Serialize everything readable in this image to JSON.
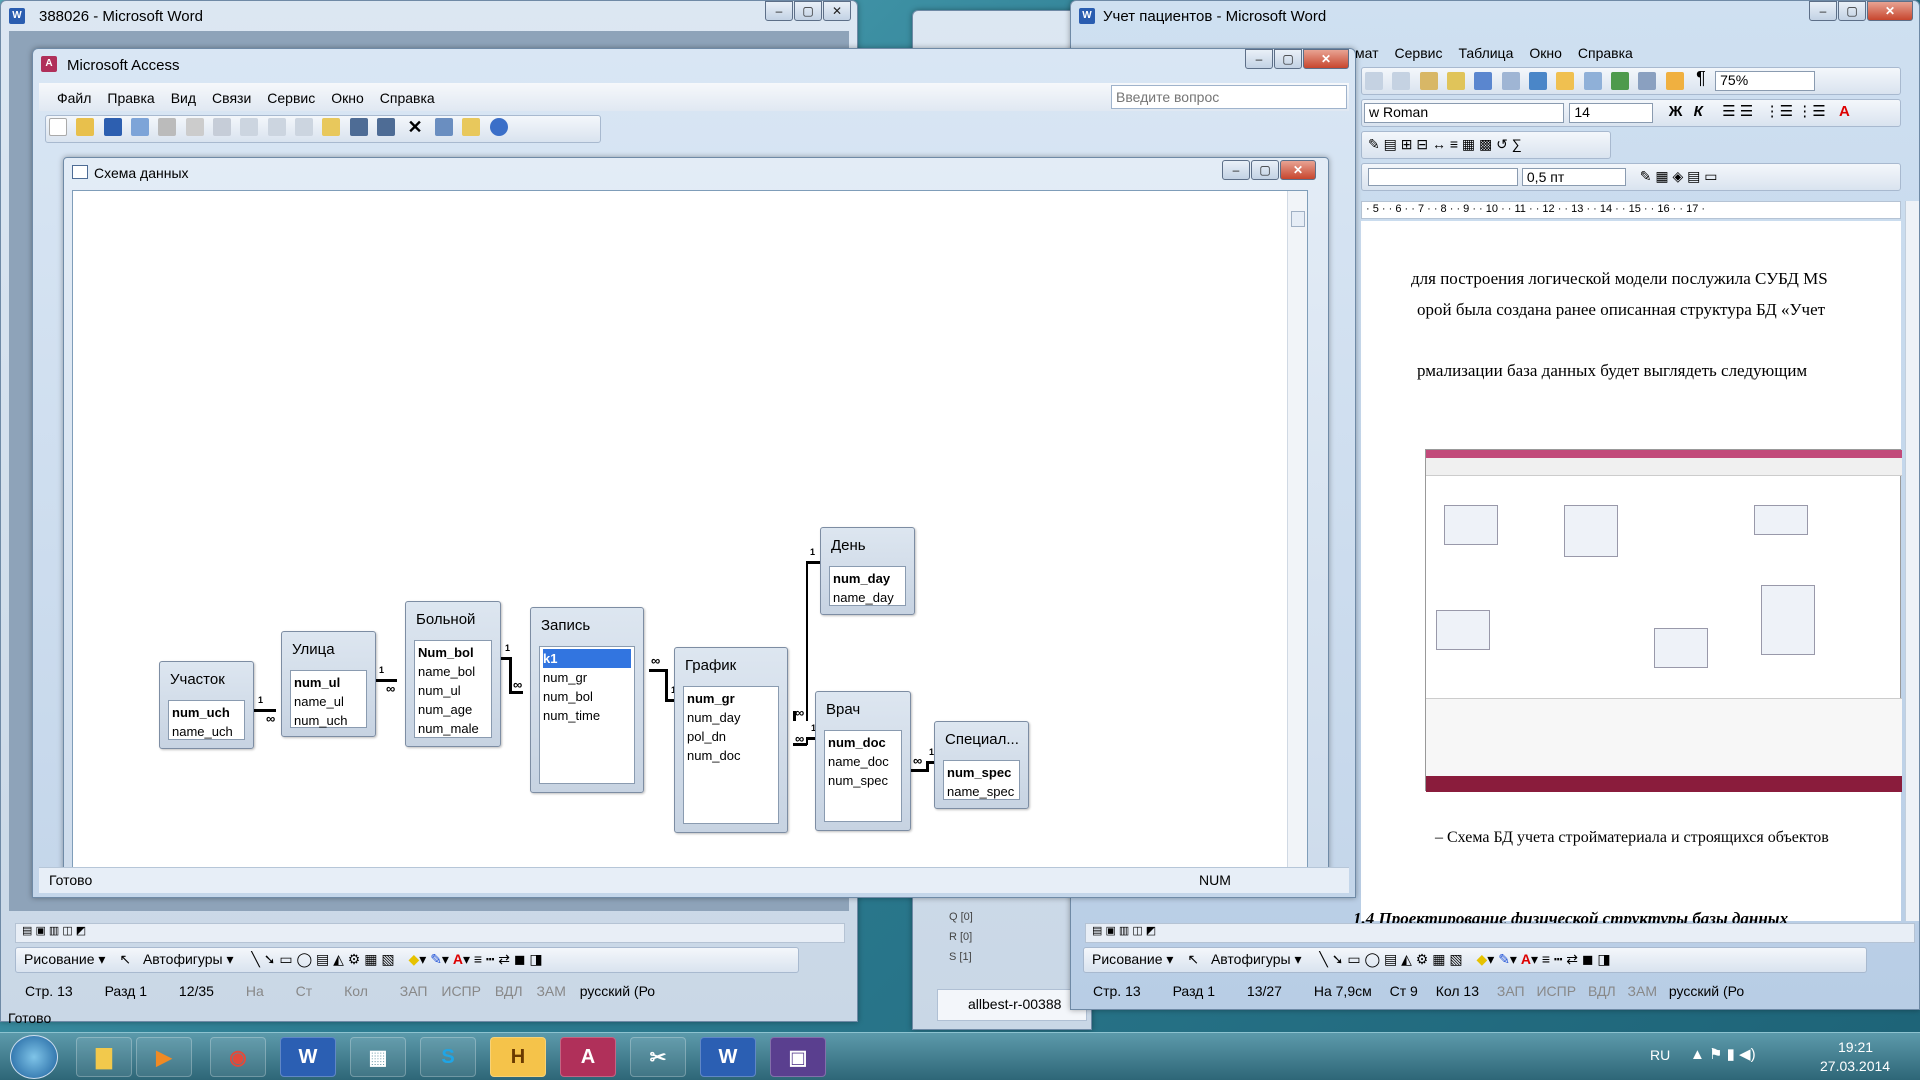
{
  "word_left": {
    "title": "388026 - Microsoft Word",
    "status": {
      "page": "Стр. 13",
      "section": "Разд 1",
      "pages": "12/35",
      "at": "На",
      "line": "Ст",
      "col": "Кол",
      "rec": "ЗАП",
      "trk": "ИСПР",
      "ext": "ВДЛ",
      "ovr": "ЗАМ",
      "lang": "русский (Ро"
    },
    "drawing": {
      "draw": "Рисование",
      "autoshapes": "Автофигуры"
    },
    "bottom": "Готово"
  },
  "word_right": {
    "title": "Учет пациентов - Microsoft Word",
    "menu": [
      "мат",
      "Сервис",
      "Таблица",
      "Окно",
      "Справка"
    ],
    "font": "w Roman",
    "size": "14",
    "zoom": "75%",
    "line_width": "0,5 пт",
    "ruler": "· 5 · · 6 · · 7 · · 8 · · 9 · · 10 · · 11 · · 12 · · 13 · · 14 · · 15 · · 16 · · 17 ·",
    "text1": "для построения логической модели послужила СУБД MS",
    "text2": "орой была создана ранее описанная структура БД «Учет",
    "text3": "рмализации база данных будет выглядеть следующим",
    "caption": "– Схема БД учета стройматериала и строящихся объектов",
    "heading": "1.4 Проектирование физической структуры базы данных",
    "status": {
      "page": "Стр. 13",
      "section": "Разд 1",
      "pages": "13/27",
      "at": "На 7,9см",
      "line": "Ст 9",
      "col": "Кол 13",
      "rec": "ЗАП",
      "trk": "ИСПР",
      "ext": "ВДЛ",
      "ovr": "ЗАМ",
      "lang": "русский (Ро"
    },
    "drawing": {
      "draw": "Рисование",
      "autoshapes": "Автофигуры"
    }
  },
  "middle": {
    "items": [
      "Q [0]",
      "R [0]",
      "S [1]"
    ],
    "tab": "allbest-r-00388"
  },
  "access": {
    "title": "Microsoft Access",
    "menu": [
      "Файл",
      "Правка",
      "Вид",
      "Связи",
      "Сервис",
      "Окно",
      "Справка"
    ],
    "question_placeholder": "Введите вопрос",
    "status": "Готово",
    "num": "NUM"
  },
  "schema": {
    "title": "Схема данных",
    "tables": [
      {
        "name": "Участок",
        "fields": [
          "num_uch",
          "name_uch"
        ]
      },
      {
        "name": "Улица",
        "fields": [
          "num_ul",
          "name_ul",
          "num_uch"
        ]
      },
      {
        "name": "Больной",
        "fields": [
          "Num_bol",
          "name_bol",
          "num_ul",
          "num_age",
          "num_male"
        ]
      },
      {
        "name": "Запись",
        "fields": [
          "k1",
          "num_gr",
          "num_bol",
          "num_time"
        ]
      },
      {
        "name": "График",
        "fields": [
          "num_gr",
          "num_day",
          "pol_dn",
          "num_doc"
        ]
      },
      {
        "name": "День",
        "fields": [
          "num_day",
          "name_day"
        ]
      },
      {
        "name": "Врач",
        "fields": [
          "num_doc",
          "name_doc",
          "num_spec"
        ]
      },
      {
        "name": "Специал...",
        "fields": [
          "num_spec",
          "name_spec"
        ]
      }
    ],
    "one": "1",
    "many": "∞"
  },
  "taskbar": {
    "lang": "RU",
    "time": "19:21",
    "date": "27.03.2014"
  }
}
